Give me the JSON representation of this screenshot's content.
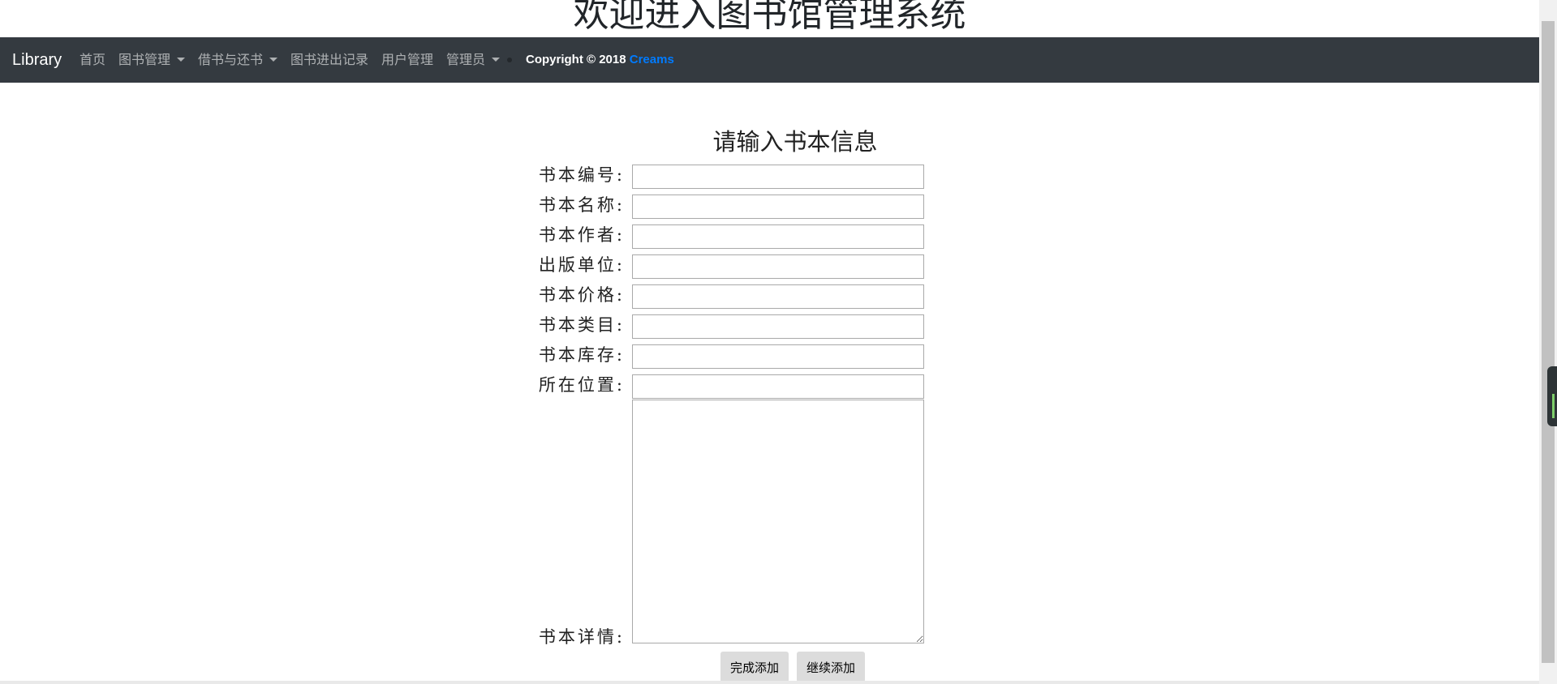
{
  "page": {
    "title": "欢迎进入图书馆管理系统"
  },
  "navbar": {
    "brand": "Library",
    "items": [
      {
        "label": "首页",
        "dropdown": false
      },
      {
        "label": "图书管理",
        "dropdown": true
      },
      {
        "label": "借书与还书",
        "dropdown": true
      },
      {
        "label": "图书进出记录",
        "dropdown": false
      },
      {
        "label": "用户管理",
        "dropdown": false
      },
      {
        "label": "管理员",
        "dropdown": true
      }
    ],
    "copyright_text": "Copyright © 2018",
    "copyright_link": "Creams"
  },
  "form": {
    "title": "请输入书本信息",
    "fields": [
      {
        "label": "书本编号:",
        "value": ""
      },
      {
        "label": "书本名称:",
        "value": ""
      },
      {
        "label": "书本作者:",
        "value": ""
      },
      {
        "label": "出版单位:",
        "value": ""
      },
      {
        "label": "书本价格:",
        "value": ""
      },
      {
        "label": "书本类目:",
        "value": ""
      },
      {
        "label": "书本库存:",
        "value": ""
      },
      {
        "label": "所在位置:",
        "value": ""
      }
    ],
    "details_label": "书本详情:",
    "details_value": "",
    "buttons": {
      "finish": "完成添加",
      "continue": "继续添加"
    }
  },
  "colors": {
    "navbar_bg": "#343a40",
    "nav_text": "rgba(255,255,255,0.6)",
    "link_accent": "#007bff",
    "button_bg": "#dcdcdc"
  }
}
